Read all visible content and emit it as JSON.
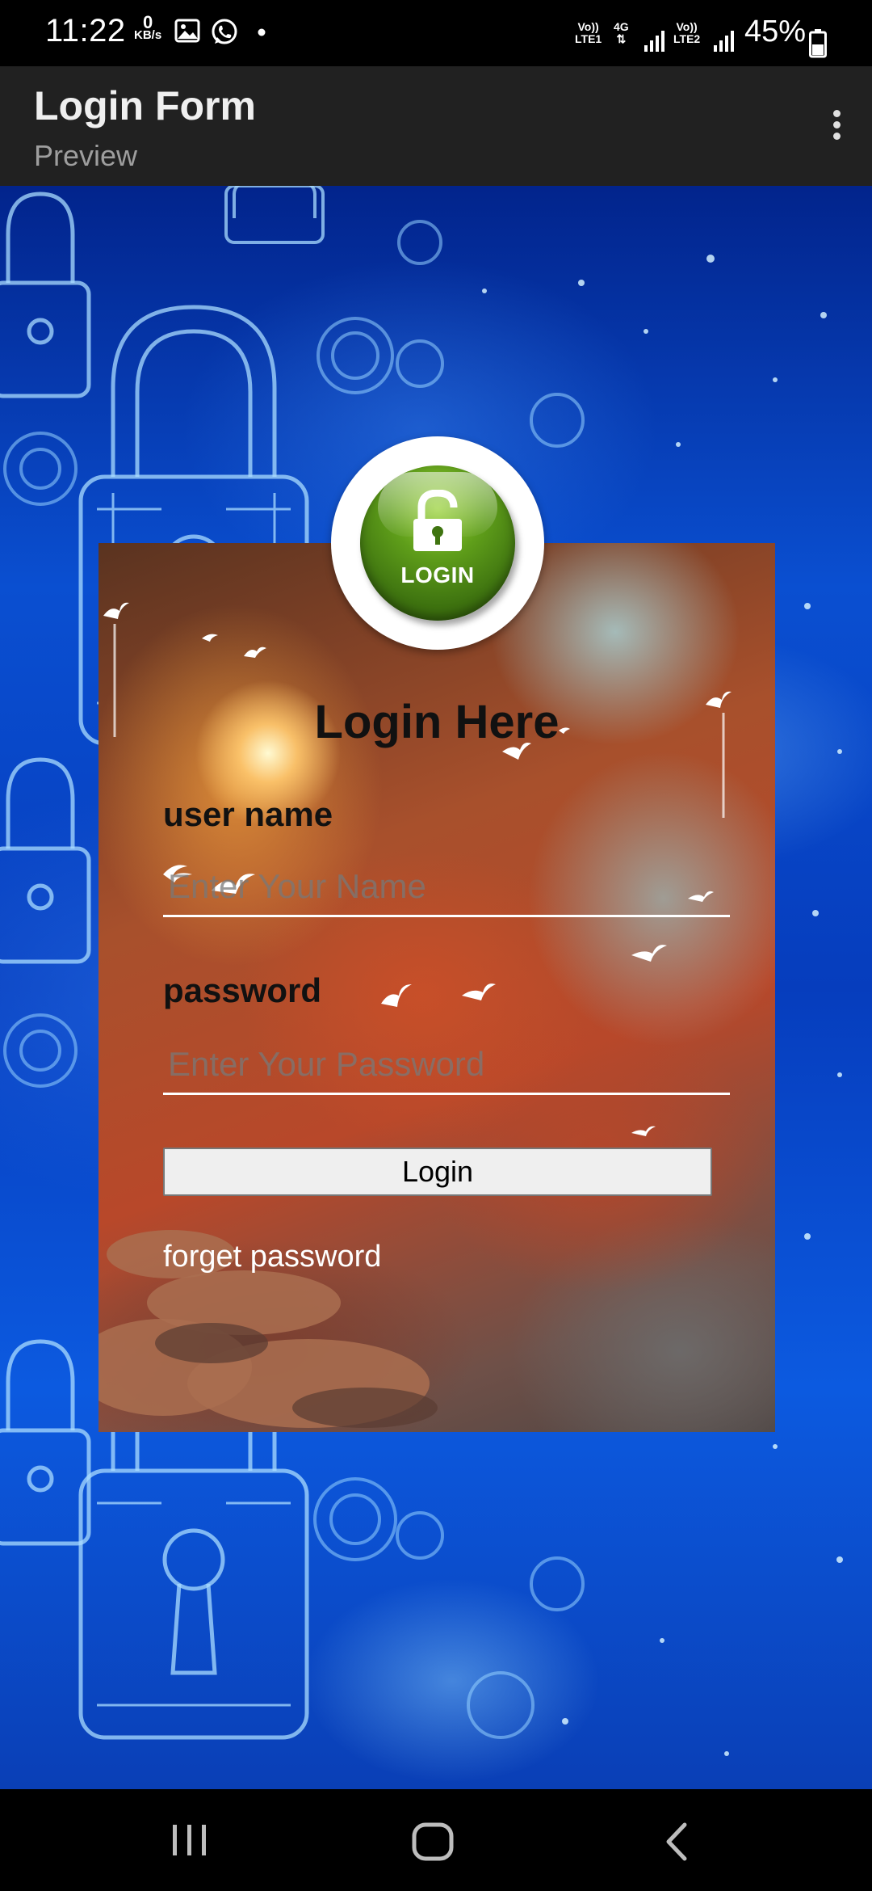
{
  "status_bar": {
    "time": "11:22",
    "data_speed_value": "0",
    "data_speed_unit": "KB/s",
    "sim1_volte": "Vo))",
    "sim1_network": "LTE1",
    "network_type": "4G",
    "sim2_volte": "Vo))",
    "sim2_network": "LTE2",
    "battery": "45%"
  },
  "app_bar": {
    "title": "Login Form",
    "subtitle": "Preview"
  },
  "form": {
    "logo_text": "LOGIN",
    "heading": "Login Here",
    "username_label": "user name",
    "username_placeholder": "Enter Your Name",
    "password_label": "password",
    "password_placeholder": "Enter Your Password",
    "login_button": "Login",
    "forget_password": "forget password"
  },
  "colors": {
    "logo_green": "#4f8a14",
    "background_blue": "#0a4fd1",
    "app_bar": "#212121"
  },
  "icons": [
    "image-icon",
    "whatsapp-icon",
    "signal-icon",
    "battery-icon",
    "lock-icon",
    "recent-apps-icon",
    "home-icon",
    "back-icon"
  ]
}
